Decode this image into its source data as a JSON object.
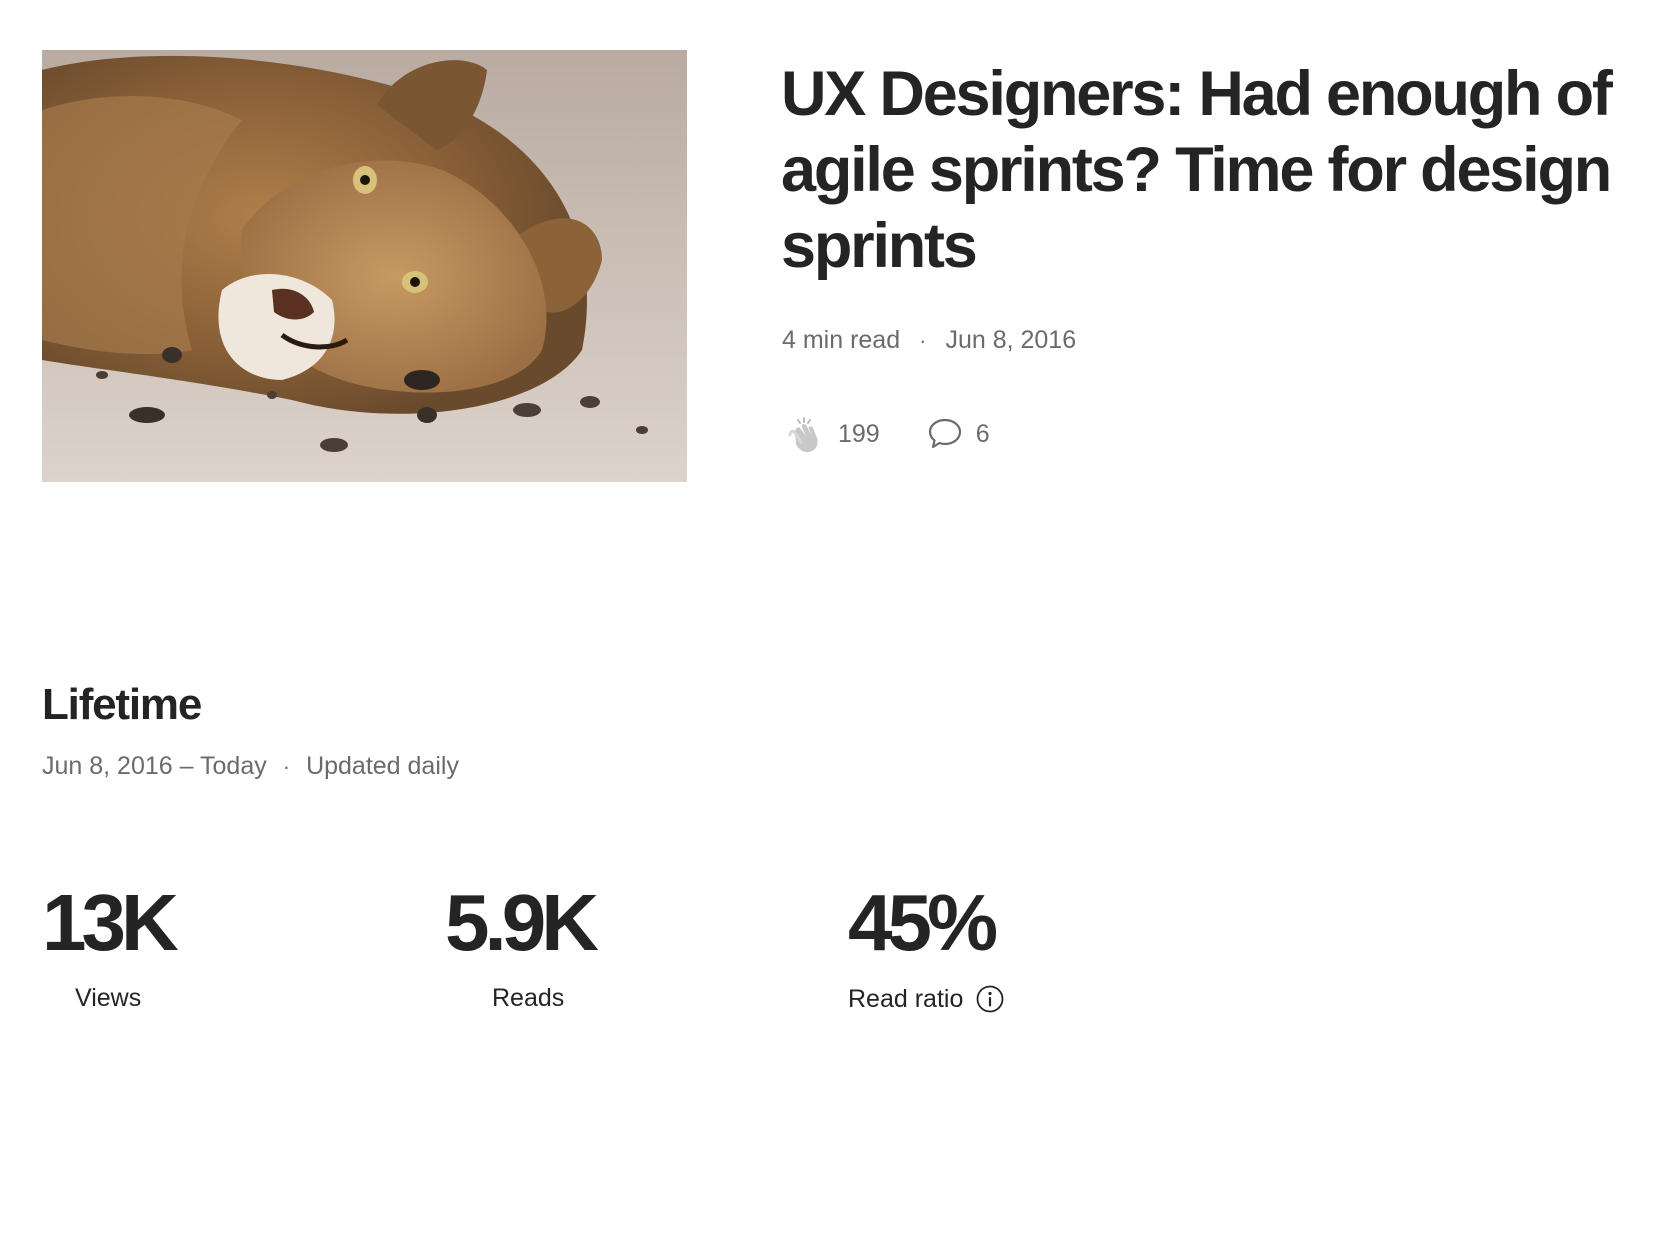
{
  "story": {
    "image_alt": "Lion lying on the ground",
    "title": "UX Designers: Had enough of agile sprints? Time for design sprints",
    "read_time": "4 min read",
    "separator": "·",
    "published": "Jun 8, 2016",
    "claps": "199",
    "responses": "6"
  },
  "lifetime": {
    "title": "Lifetime",
    "range": "Jun 8, 2016 – Today",
    "separator": "·",
    "update_note": "Updated daily"
  },
  "stats": {
    "views": {
      "value": "13K",
      "label": "Views"
    },
    "reads": {
      "value": "5.9K",
      "label": "Reads"
    },
    "read_ratio": {
      "value": "45%",
      "label": "Read ratio"
    }
  },
  "colors": {
    "text_primary": "#242424",
    "text_secondary": "#6b6b6b",
    "background": "#ffffff"
  },
  "icons": {
    "clap": "clap-icon",
    "response": "response-bubble-icon",
    "info": "info-icon"
  }
}
